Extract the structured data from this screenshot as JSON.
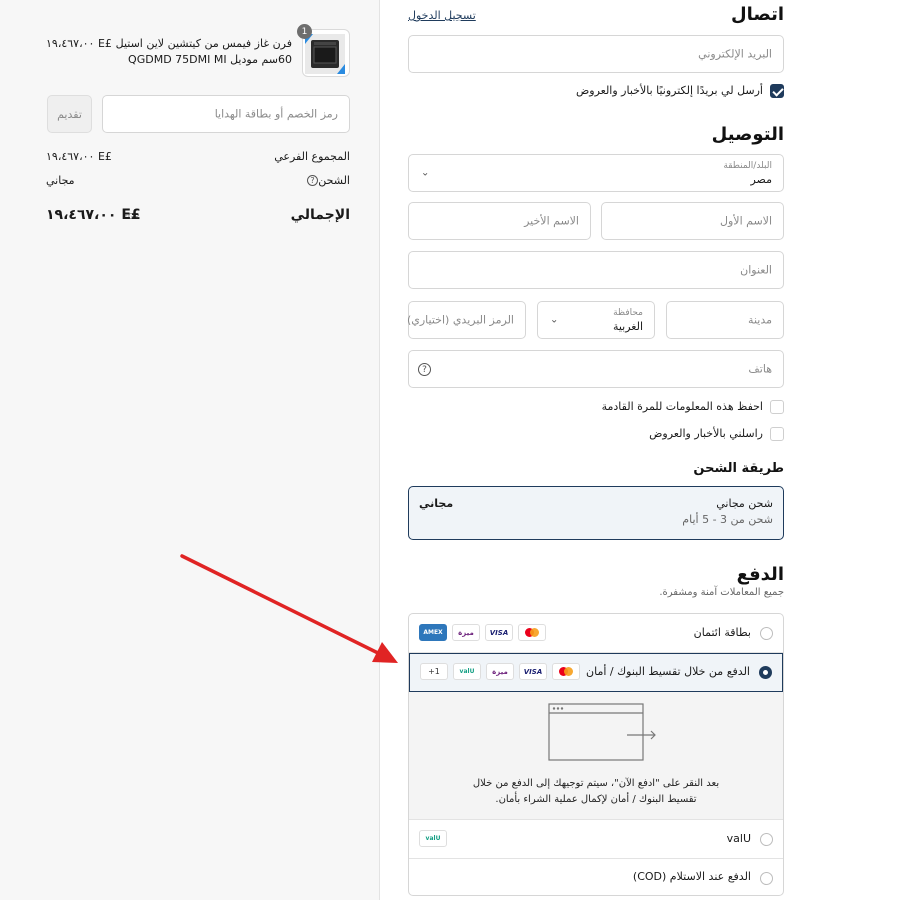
{
  "contact": {
    "title": "اتصال",
    "login_link": "تسجيل الدخول",
    "email_placeholder": "البريد الإلكتروني",
    "email_offers_label": "أرسل لي بريدًا إلكترونيًا بالأخبار والعروض"
  },
  "delivery": {
    "title": "التوصيل",
    "country_label": "البلد/المنطقة",
    "country_value": "مصر",
    "first_name_placeholder": "الاسم الأول",
    "last_name_placeholder": "الاسم الأخير",
    "address_placeholder": "العنوان",
    "city_placeholder": "مدينة",
    "governorate_label": "محافظة",
    "governorate_value": "الغربية",
    "postal_placeholder": "الرمز البريدي (اختياري)",
    "phone_placeholder": "هاتف",
    "save_info_label": "احفظ هذه المعلومات للمرة القادمة",
    "text_offers_label": "راسلني بالأخبار والعروض"
  },
  "shipping_method": {
    "title": "طريقة الشحن",
    "option_name": "شحن مجاني",
    "option_eta": "شحن من 3 - 5 أيام",
    "option_price": "مجاني"
  },
  "payment": {
    "title": "الدفع",
    "subtitle": "جميع المعاملات آمنة ومشفرة.",
    "options": [
      {
        "label": "بطاقة ائتمان",
        "selected": false
      },
      {
        "label": "الدفع من خلال تقسيط البنوك / أمان",
        "selected": true
      },
      {
        "label": "valU",
        "selected": false
      },
      {
        "label": "الدفع عند الاستلام (COD)",
        "selected": false
      }
    ],
    "more_logos": "+1",
    "redirect_note_line1": "بعد النقر على \"ادفع الآن\"، سيتم توجيهك إلى الدفع من خلال",
    "redirect_note_line2": "تقسيط البنوك / أمان لإكمال عملية الشراء بأمان.",
    "logos": {
      "visa": "VISA",
      "amex": "AMEX",
      "meeza": "ميزة",
      "valu": "valU"
    }
  },
  "summary": {
    "item_qty": "1",
    "item_name_line1": "فرن غاز فيمس من كيتشين لاين استيل",
    "item_name_line2": "60سم موديل QGDMD 75DMI MI",
    "item_price": "£E ١٩،٤٦٧،٠٠",
    "discount_placeholder": "رمز الخصم أو بطاقة الهدايا",
    "apply_label": "تقديم",
    "subtotal_label": "المجموع الفرعي",
    "subtotal_value": "£E ١٩،٤٦٧،٠٠",
    "shipping_label": "الشحن",
    "shipping_value": "مجاني",
    "total_label": "الإجمالي",
    "total_currency": "EGP",
    "total_value": "£E ١٩،٤٦٧،٠٠"
  },
  "colors": {
    "accent": "#1f3b5c",
    "annotation_arrow": "#e02424"
  }
}
